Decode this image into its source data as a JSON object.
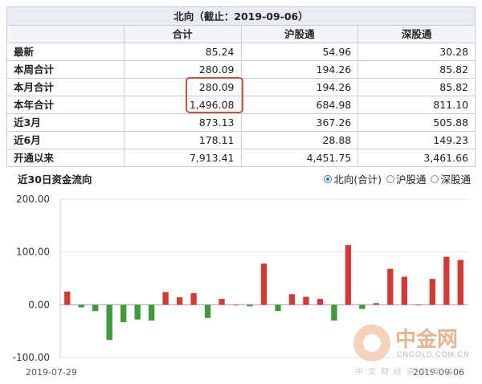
{
  "table": {
    "title": "北向（截止：2019-09-06）",
    "columns": [
      "",
      "合计",
      "沪股通",
      "深股通"
    ],
    "rows": [
      {
        "label": "最新",
        "total": "85.24",
        "sh": "54.96",
        "sz": "30.28"
      },
      {
        "label": "本周合计",
        "total": "280.09",
        "sh": "194.26",
        "sz": "85.82"
      },
      {
        "label": "本月合计",
        "total": "280.09",
        "sh": "194.26",
        "sz": "85.82"
      },
      {
        "label": "本年合计",
        "total": "1,496.08",
        "sh": "684.98",
        "sz": "811.10"
      },
      {
        "label": "近3月",
        "total": "873.13",
        "sh": "367.26",
        "sz": "505.88"
      },
      {
        "label": "近6月",
        "total": "178.11",
        "sh": "28.88",
        "sz": "149.23"
      },
      {
        "label": "开通以来",
        "total": "7,913.41",
        "sh": "4,451.75",
        "sz": "3,461.66"
      }
    ]
  },
  "chart_header": {
    "title": "近30日资金流向",
    "options": [
      "北向(合计)",
      "沪股通",
      "深股通"
    ],
    "selected": 0
  },
  "chart_data": {
    "type": "bar",
    "title": "近30日资金流向",
    "x_start": "2019-07-29",
    "x_end": "2019-09-06",
    "ylim": [
      -100,
      200
    ],
    "yticks": [
      "200.00",
      "100.00",
      "0.00",
      "-100.00"
    ],
    "grid": true,
    "values": [
      25,
      -5,
      -12,
      -67,
      -33,
      -28,
      -30,
      24,
      14,
      22,
      -25,
      11,
      0,
      -3,
      78,
      -12,
      20,
      15,
      11,
      -30,
      113,
      -8,
      3,
      68,
      53,
      0,
      49,
      91,
      85
    ],
    "positive_color": "#d33a35",
    "negative_color": "#3f9a3a"
  },
  "watermark": {
    "logo": "中金网",
    "domain": "CNGOLD.COM.CN",
    "slogan": "中文财经资讯媒体"
  }
}
